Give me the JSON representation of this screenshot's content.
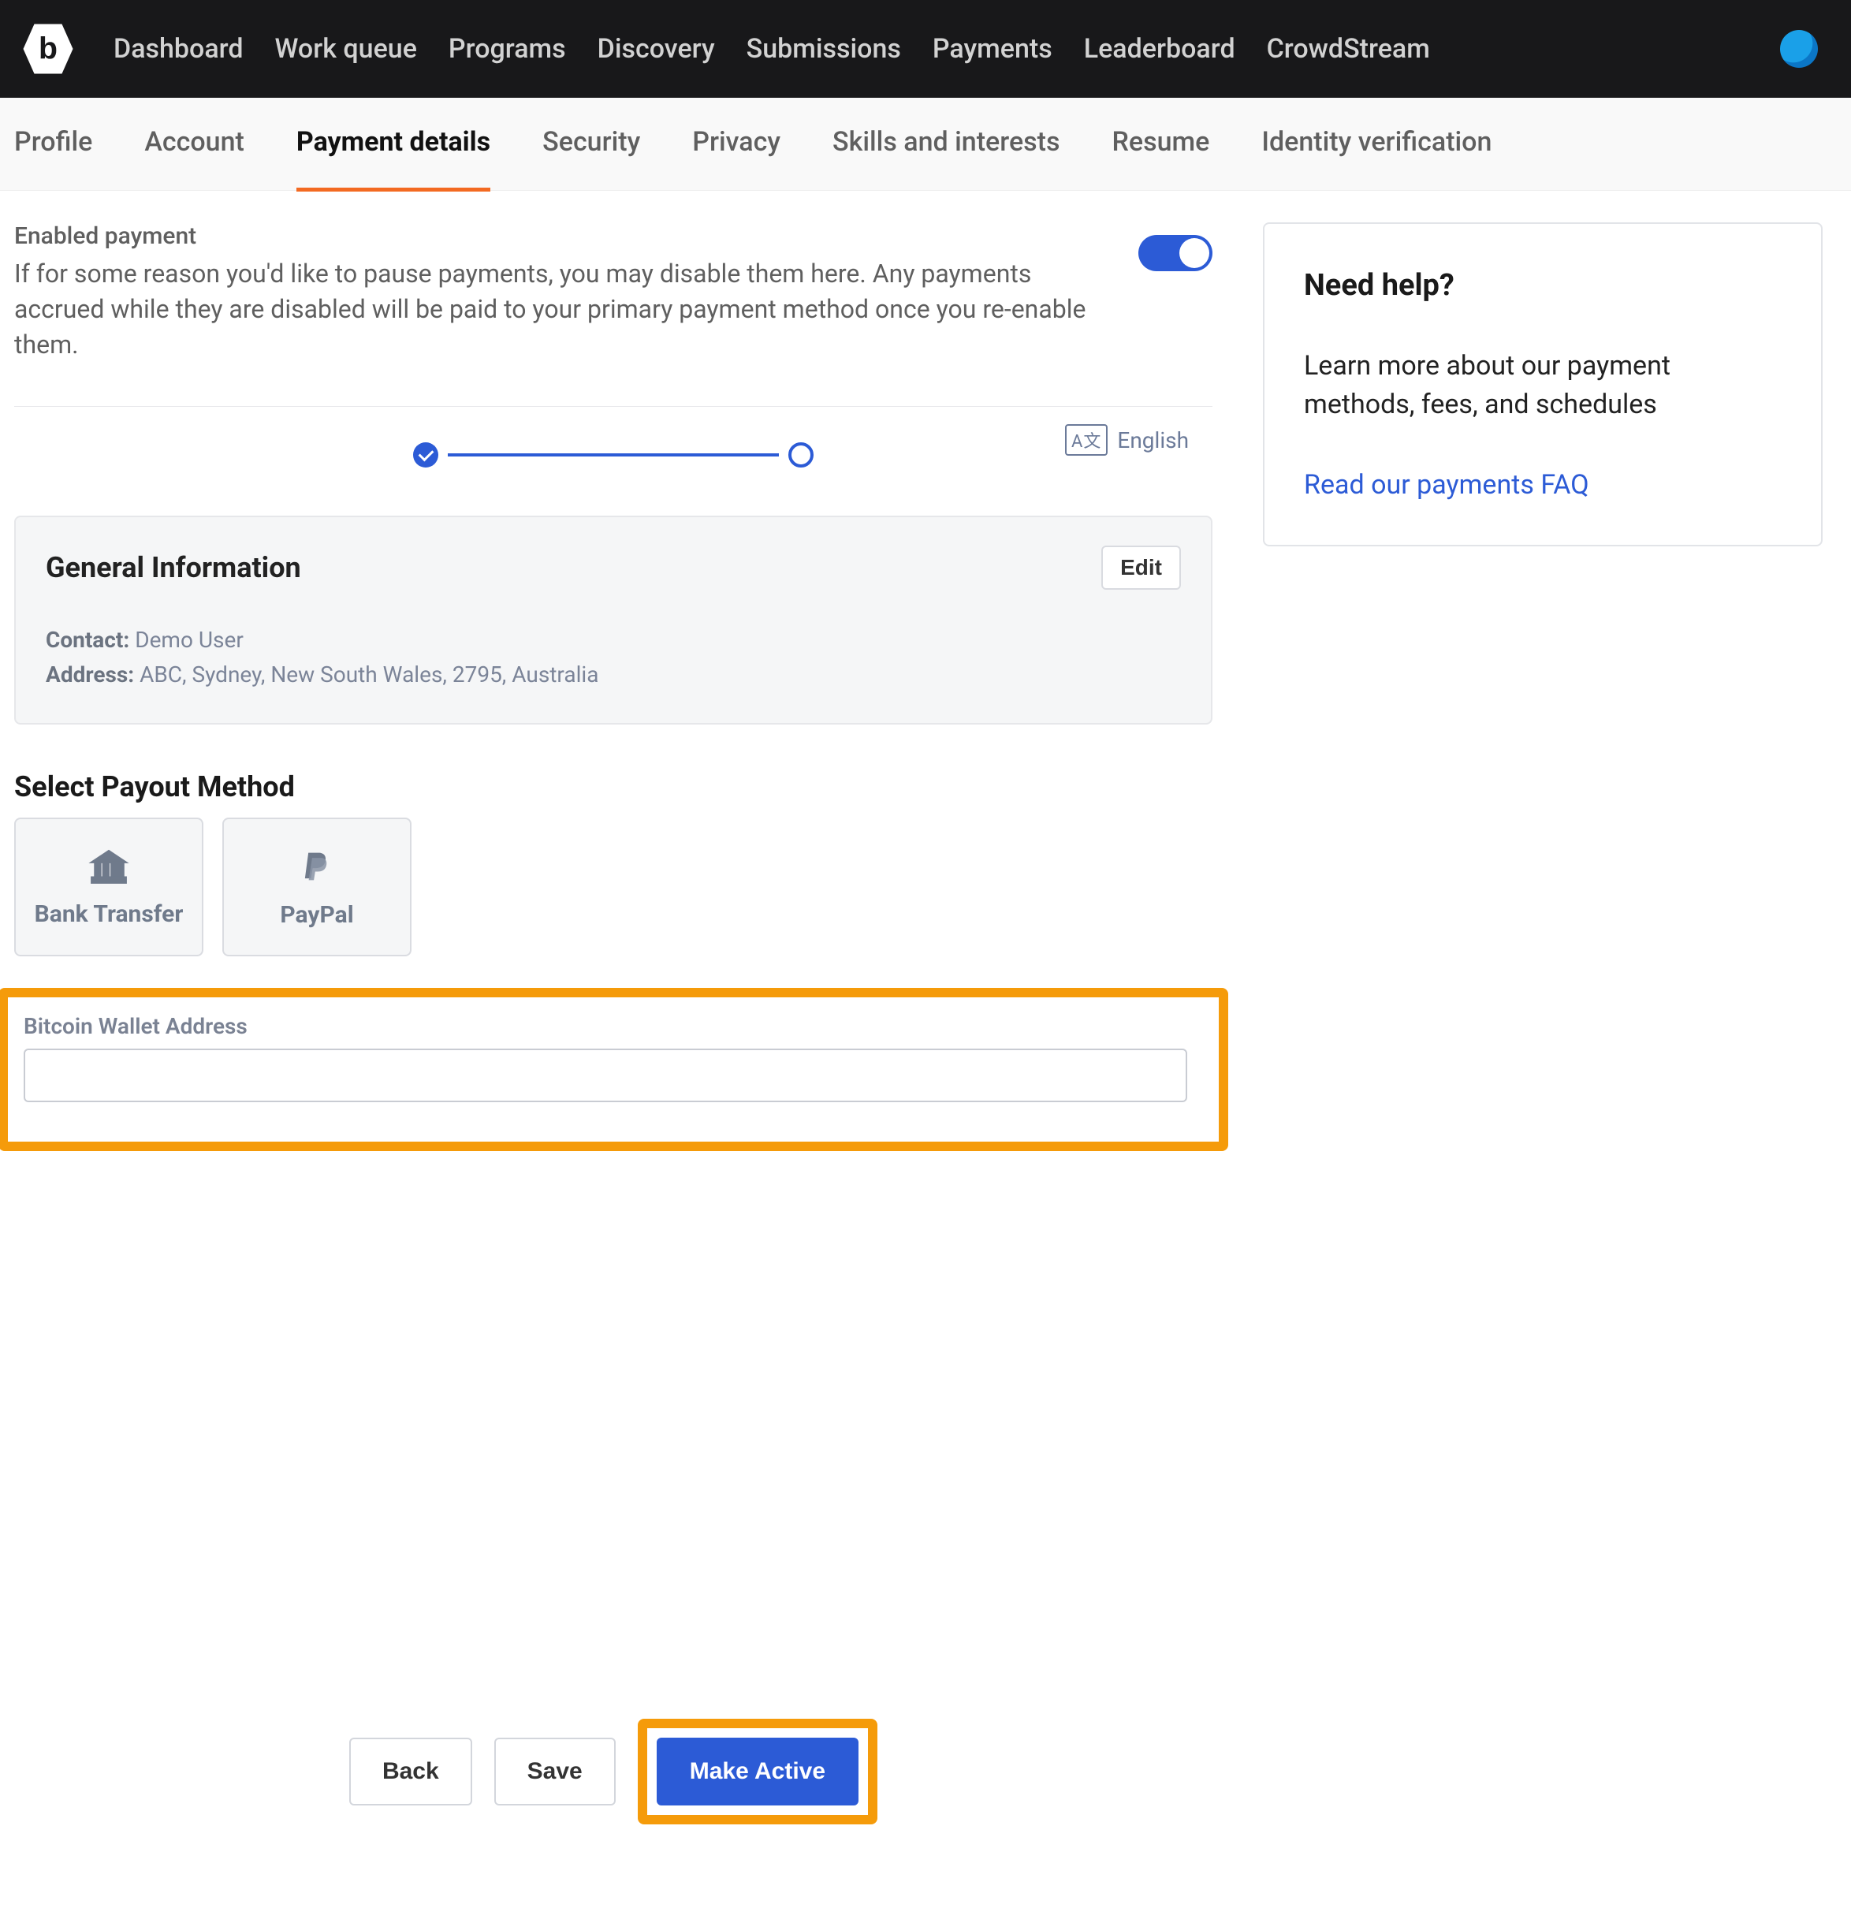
{
  "nav": {
    "items": [
      "Dashboard",
      "Work queue",
      "Programs",
      "Discovery",
      "Submissions",
      "Payments",
      "Leaderboard",
      "CrowdStream"
    ]
  },
  "tabs": {
    "items": [
      {
        "label": "Profile",
        "active": false
      },
      {
        "label": "Account",
        "active": false
      },
      {
        "label": "Payment details",
        "active": true
      },
      {
        "label": "Security",
        "active": false
      },
      {
        "label": "Privacy",
        "active": false
      },
      {
        "label": "Skills and interests",
        "active": false
      },
      {
        "label": "Resume",
        "active": false
      },
      {
        "label": "Identity verification",
        "active": false
      }
    ]
  },
  "enable": {
    "title": "Enabled payment",
    "desc": "If for some reason you'd like to pause payments, you may disable them here. Any payments accrued while they are disabled will be paid to your primary payment method once you re-enable them.",
    "on": true
  },
  "language": {
    "icon": "A文",
    "label": "English"
  },
  "general": {
    "title": "General Information",
    "edit": "Edit",
    "contact_label": "Contact:",
    "contact_value": "Demo User",
    "address_label": "Address:",
    "address_value": "ABC, Sydney, New South Wales, 2795, Australia"
  },
  "payout": {
    "title": "Select Payout Method",
    "methods": [
      {
        "key": "bank",
        "label": "Bank Transfer"
      },
      {
        "key": "paypal",
        "label": "PayPal"
      }
    ]
  },
  "wallet": {
    "label": "Bitcoin Wallet Address",
    "value": ""
  },
  "actions": {
    "back": "Back",
    "save": "Save",
    "make_active": "Make Active"
  },
  "help": {
    "title": "Need help?",
    "text": "Learn more about our payment methods, fees, and schedules",
    "link": "Read our payments FAQ"
  }
}
